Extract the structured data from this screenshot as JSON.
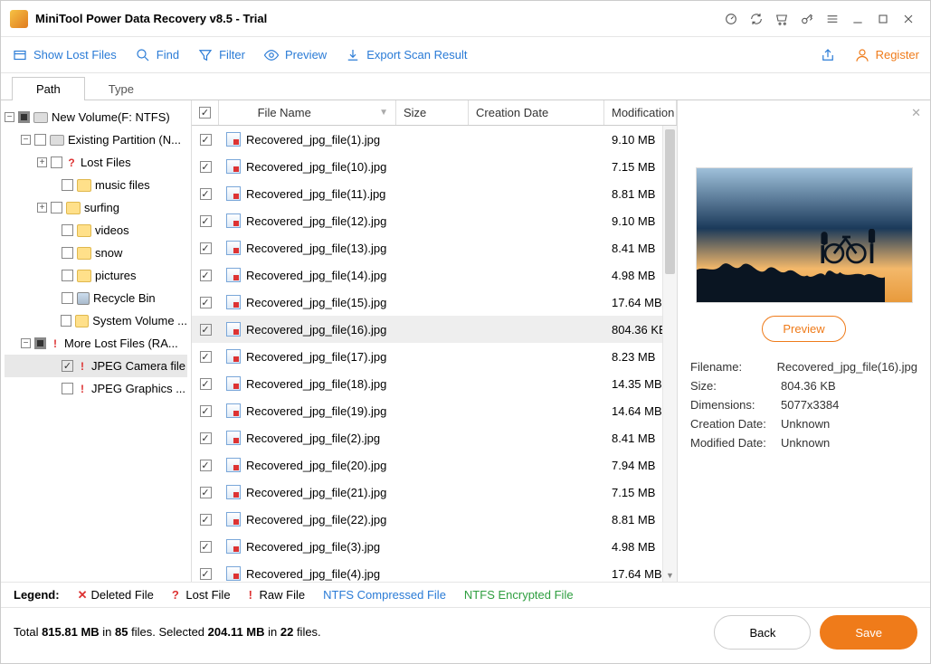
{
  "app": {
    "title": "MiniTool Power Data Recovery v8.5 - Trial"
  },
  "toolbar": {
    "show_lost": "Show Lost Files",
    "find": "Find",
    "filter": "Filter",
    "preview": "Preview",
    "export": "Export Scan Result",
    "register": "Register"
  },
  "tabs": {
    "path": "Path",
    "type": "Type"
  },
  "tree": {
    "root": "New Volume(F: NTFS)",
    "existing": "Existing Partition (N...",
    "lost_files": "Lost Files",
    "music": "music files",
    "surfing": "surfing",
    "videos": "videos",
    "snow": "snow",
    "pictures": "pictures",
    "recycle": "Recycle Bin",
    "sysvol": "System Volume ...",
    "more_lost": "More Lost Files (RA...",
    "jpeg_cam": "JPEG Camera file",
    "jpeg_gfx": "JPEG Graphics ..."
  },
  "columns": {
    "name": "File Name",
    "size": "Size",
    "cdate": "Creation Date",
    "mdate": "Modification"
  },
  "files": [
    {
      "name": "Recovered_jpg_file(1).jpg",
      "size": "9.10 MB"
    },
    {
      "name": "Recovered_jpg_file(10).jpg",
      "size": "7.15 MB"
    },
    {
      "name": "Recovered_jpg_file(11).jpg",
      "size": "8.81 MB"
    },
    {
      "name": "Recovered_jpg_file(12).jpg",
      "size": "9.10 MB"
    },
    {
      "name": "Recovered_jpg_file(13).jpg",
      "size": "8.41 MB"
    },
    {
      "name": "Recovered_jpg_file(14).jpg",
      "size": "4.98 MB"
    },
    {
      "name": "Recovered_jpg_file(15).jpg",
      "size": "17.64 MB"
    },
    {
      "name": "Recovered_jpg_file(16).jpg",
      "size": "804.36 KB",
      "selected": true
    },
    {
      "name": "Recovered_jpg_file(17).jpg",
      "size": "8.23 MB"
    },
    {
      "name": "Recovered_jpg_file(18).jpg",
      "size": "14.35 MB"
    },
    {
      "name": "Recovered_jpg_file(19).jpg",
      "size": "14.64 MB"
    },
    {
      "name": "Recovered_jpg_file(2).jpg",
      "size": "8.41 MB"
    },
    {
      "name": "Recovered_jpg_file(20).jpg",
      "size": "7.94 MB"
    },
    {
      "name": "Recovered_jpg_file(21).jpg",
      "size": "7.15 MB"
    },
    {
      "name": "Recovered_jpg_file(22).jpg",
      "size": "8.81 MB"
    },
    {
      "name": "Recovered_jpg_file(3).jpg",
      "size": "4.98 MB"
    },
    {
      "name": "Recovered_jpg_file(4).jpg",
      "size": "17.64 MB"
    }
  ],
  "preview": {
    "button": "Preview",
    "filename_lbl": "Filename:",
    "filename_val": "Recovered_jpg_file(16).jpg",
    "size_lbl": "Size:",
    "size_val": "804.36 KB",
    "dim_lbl": "Dimensions:",
    "dim_val": "5077x3384",
    "cdate_lbl": "Creation Date:",
    "cdate_val": "Unknown",
    "mdate_lbl": "Modified Date:",
    "mdate_val": "Unknown"
  },
  "legend": {
    "label": "Legend:",
    "deleted": "Deleted File",
    "lost": "Lost File",
    "raw": "Raw File",
    "ntfs_comp": "NTFS Compressed File",
    "ntfs_enc": "NTFS Encrypted File"
  },
  "footer": {
    "total_a": "Total ",
    "total_b": "815.81 MB",
    "total_c": " in ",
    "total_d": "85",
    "total_e": " files.   Selected ",
    "total_f": "204.11 MB",
    "total_g": " in ",
    "total_h": "22",
    "total_i": " files.",
    "back": "Back",
    "save": "Save"
  }
}
